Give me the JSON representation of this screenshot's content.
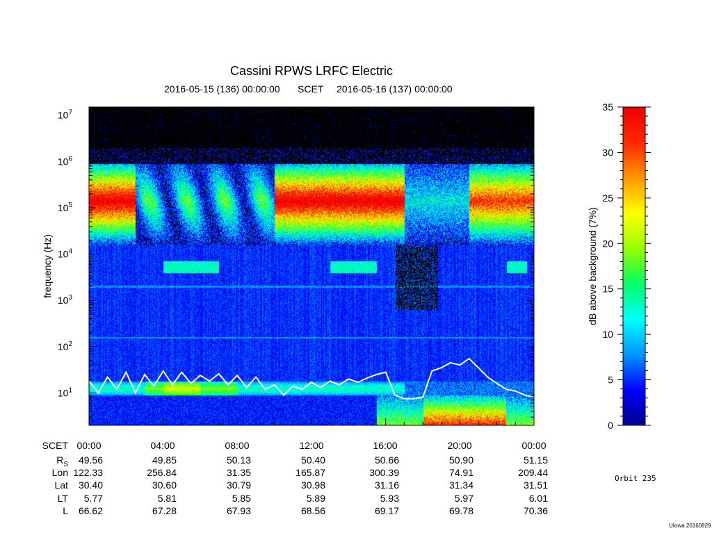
{
  "chart_data": {
    "type": "heatmap",
    "title": "Cassini RPWS LRFC Electric",
    "subtitle": {
      "start": "2016-05-15 (136) 00:00:00",
      "middle": "SCET",
      "end": "2016-05-16 (137) 00:00:00"
    },
    "ylabel": "frequency (Hz)",
    "yscale": "log",
    "ylim": [
      2,
      15000000
    ],
    "y_ticks": [
      {
        "value": 10,
        "mantissa": "10",
        "exp": "1"
      },
      {
        "value": 100,
        "mantissa": "10",
        "exp": "2"
      },
      {
        "value": 1000,
        "mantissa": "10",
        "exp": "3"
      },
      {
        "value": 10000,
        "mantissa": "10",
        "exp": "4"
      },
      {
        "value": 100000,
        "mantissa": "10",
        "exp": "5"
      },
      {
        "value": 1000000,
        "mantissa": "10",
        "exp": "6"
      },
      {
        "value": 10000000,
        "mantissa": "10",
        "exp": "7"
      }
    ],
    "xlim": [
      0,
      24
    ],
    "colorbar": {
      "label": "dB above background (7%)",
      "range": [
        0,
        35
      ],
      "ticks": [
        "0",
        "5",
        "10",
        "15",
        "20",
        "25",
        "30",
        "35"
      ],
      "colors": [
        "#00008c",
        "#0000ff",
        "#0096ff",
        "#00ffff",
        "#00ff64",
        "#96ff00",
        "#ffff00",
        "#ff9600",
        "#ff2800",
        "#f00000"
      ]
    },
    "white_trace": {
      "x": [
        0,
        0.5,
        1,
        1.5,
        2,
        2.5,
        3,
        3.5,
        4,
        4.5,
        5,
        5.5,
        6,
        6.5,
        7,
        7.5,
        8,
        8.5,
        9,
        9.5,
        10,
        10.5,
        11,
        11.5,
        12,
        12.5,
        13,
        13.5,
        14,
        14.5,
        15,
        15.5,
        16,
        16.5,
        17,
        17.5,
        18,
        18.5,
        19,
        19.5,
        20,
        20.5,
        21,
        21.5,
        22,
        22.5,
        23,
        23.5,
        24
      ],
      "y": [
        18,
        10,
        22,
        12,
        28,
        10,
        25,
        14,
        30,
        15,
        28,
        16,
        24,
        18,
        26,
        15,
        24,
        13,
        22,
        12,
        15,
        9,
        14,
        12,
        17,
        13,
        18,
        15,
        20,
        17,
        21,
        25,
        28,
        9,
        7.5,
        7.5,
        8,
        30,
        35,
        45,
        40,
        55,
        35,
        22,
        16,
        12,
        11,
        9,
        8
      ]
    },
    "rows": {
      "scet": {
        "label": "SCET",
        "values": [
          "00:00",
          "04:00",
          "08:00",
          "12:00",
          "16:00",
          "20:00",
          "00:00"
        ]
      },
      "rs": {
        "label": "R",
        "sub": "S",
        "values": [
          "49.56",
          "49.85",
          "50.13",
          "50.40",
          "50.66",
          "50.90",
          "51.15"
        ]
      },
      "lon": {
        "label": "Lon",
        "values": [
          "122.33",
          "256.84",
          "31.35",
          "165.87",
          "300.39",
          "74.91",
          "209.44"
        ]
      },
      "lat": {
        "label": "Lat",
        "values": [
          "30.40",
          "30.60",
          "30.79",
          "30.98",
          "31.16",
          "31.34",
          "31.51"
        ]
      },
      "lt": {
        "label": "LT",
        "values": [
          "5.77",
          "5.81",
          "5.85",
          "5.89",
          "5.93",
          "5.97",
          "6.01"
        ]
      },
      "l": {
        "label": "L",
        "values": [
          "66.62",
          "67.28",
          "67.93",
          "68.56",
          "69.17",
          "69.78",
          "70.36"
        ]
      }
    }
  },
  "orbit": "Orbit  235",
  "credit": "UIowa 20160929"
}
